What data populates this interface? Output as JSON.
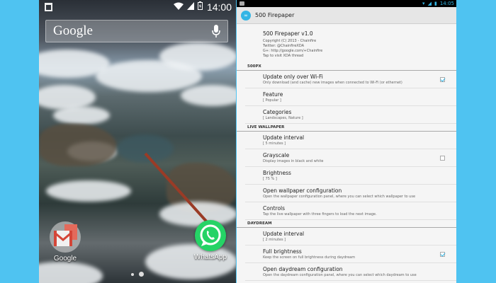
{
  "left_phone": {
    "status": {
      "time": "14:00"
    },
    "search": {
      "logo": "Google"
    },
    "apps": [
      {
        "label": "Google"
      },
      {
        "label": "WhatsApp"
      }
    ]
  },
  "right_phone": {
    "status": {
      "time": "14:05"
    },
    "action_bar": {
      "title": "500 Firepaper"
    },
    "about": {
      "title": "500 Firepaper v1.0",
      "lines": [
        "Copyright (C) 2013 - Chainfire",
        "Twitter: @ChainfireXDA",
        "G+: http://google.com/+Chainfire",
        "Tap to visit XDA thread"
      ]
    },
    "categories": [
      {
        "label": "500PX",
        "items": [
          {
            "title": "Update only over Wi-Fi",
            "summary": "Only download (and cache) new images when connected to Wi-Fi (or ethernet)",
            "checkbox": true,
            "checked": true
          },
          {
            "title": "Feature",
            "summary": "[ Popular ]"
          },
          {
            "title": "Categories",
            "summary": "[ Landscapes, Nature ]"
          }
        ]
      },
      {
        "label": "LIVE WALLPAPER",
        "items": [
          {
            "title": "Update interval",
            "summary": "[ 5 minutes ]"
          },
          {
            "title": "Grayscale",
            "summary": "Display images in black and white",
            "checkbox": true,
            "checked": false
          },
          {
            "title": "Brightness",
            "summary": "[ 75 % ]"
          },
          {
            "title": "Open wallpaper configuration",
            "summary": "Open the wallpaper configuration panel, where you can select which wallpaper to use"
          },
          {
            "title": "Controls",
            "summary": "Tap the live wallpaper with three fingers to load the next image."
          }
        ]
      },
      {
        "label": "DAYDREAM",
        "items": [
          {
            "title": "Update interval",
            "summary": "[ 2 minutes ]"
          },
          {
            "title": "Full brightness",
            "summary": "Keep the screen on full brightness during daydream",
            "checkbox": true,
            "checked": true
          },
          {
            "title": "Open daydream configuration",
            "summary": "Open the daydream configuration panel, where you can select which daydream to use"
          }
        ]
      }
    ]
  }
}
